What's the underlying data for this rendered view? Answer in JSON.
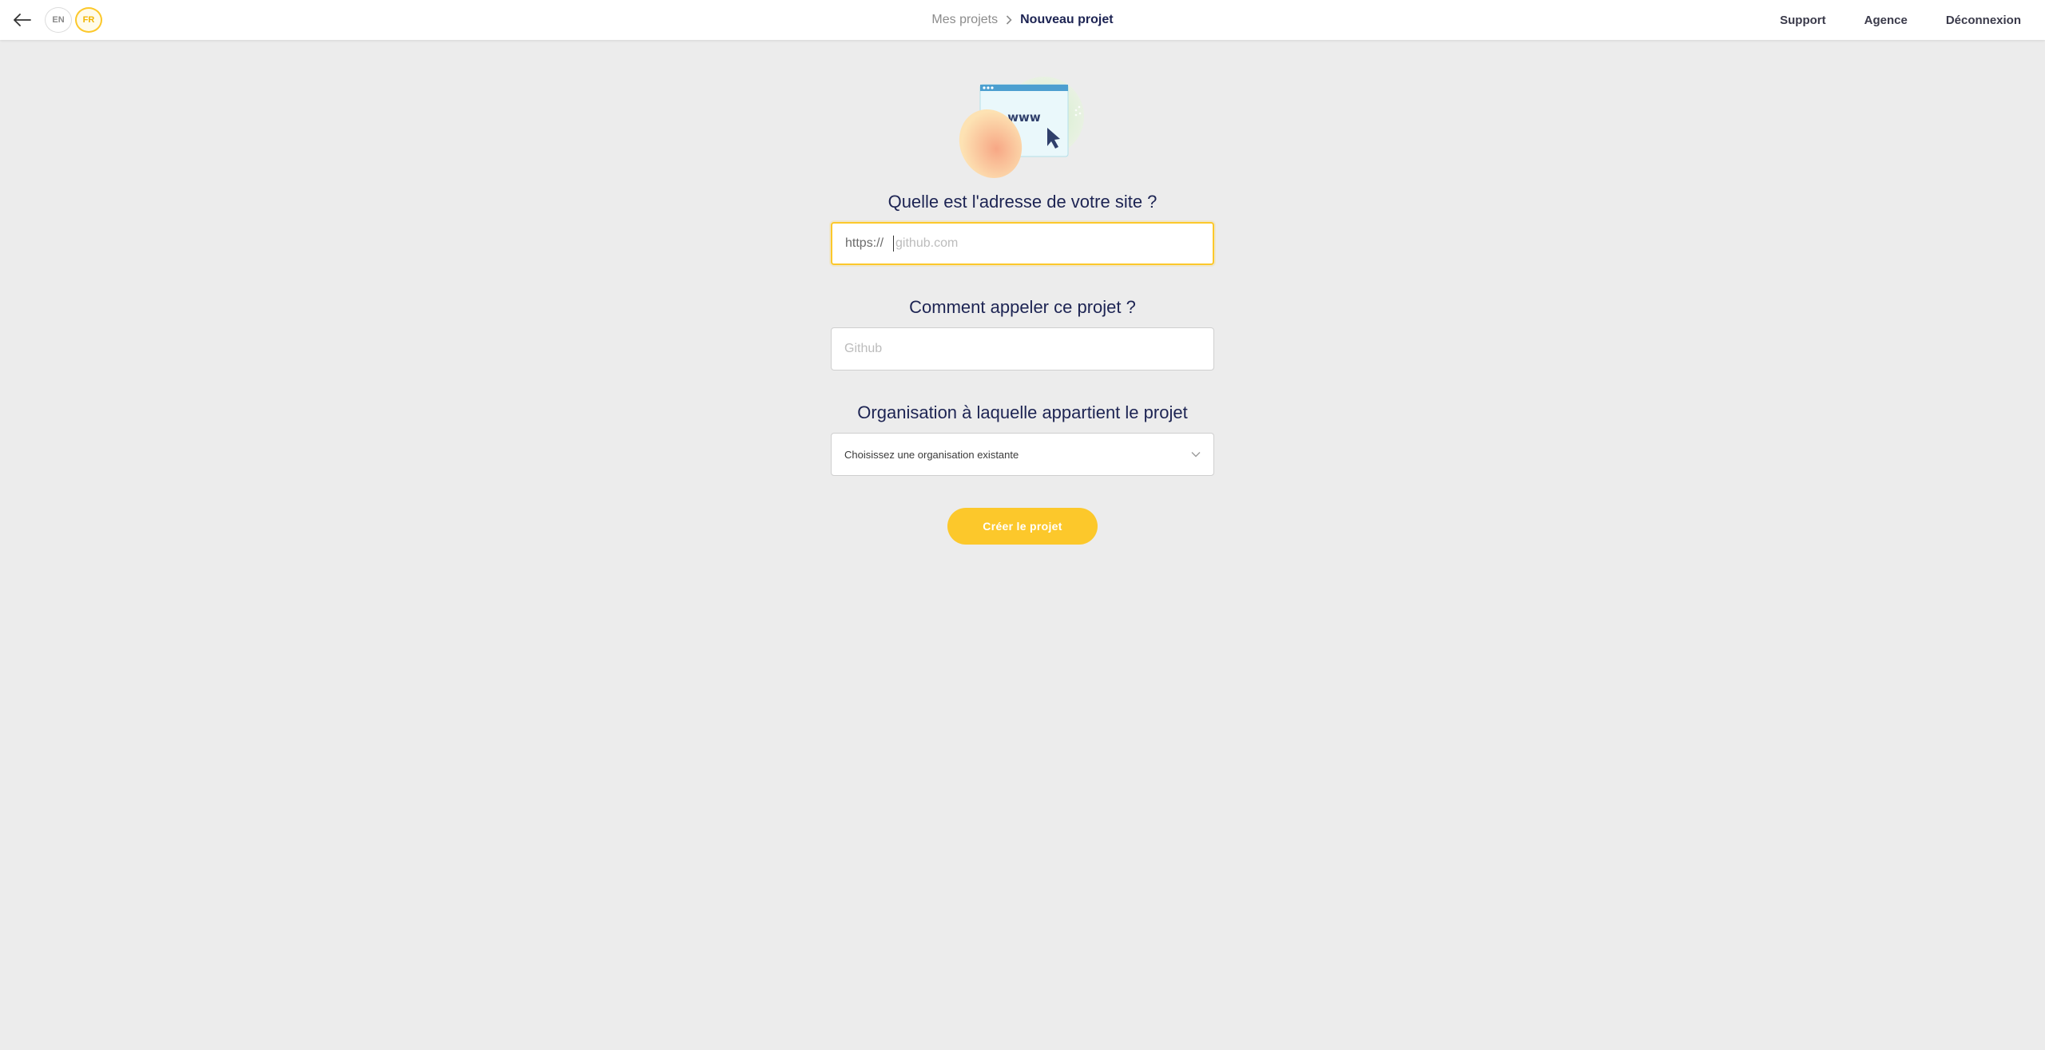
{
  "header": {
    "languages": [
      {
        "code": "EN",
        "active": false
      },
      {
        "code": "FR",
        "active": true
      }
    ],
    "breadcrumb": {
      "previous": "Mes projets",
      "current": "Nouveau projet"
    },
    "nav": {
      "support": "Support",
      "agency": "Agence",
      "logout": "Déconnexion"
    }
  },
  "illustration": {
    "text": "www"
  },
  "form": {
    "url_question": "Quelle est l'adresse de votre site ?",
    "url_prefix": "https://",
    "url_placeholder": "github.com",
    "name_question": "Comment appeler ce projet ?",
    "name_placeholder": "Github",
    "org_question": "Organisation à laquelle appartient le projet",
    "org_select_value": "Choisissez une organisation existante",
    "submit_label": "Créer le projet"
  },
  "colors": {
    "accent": "#fcc82b",
    "text_primary": "#1d2453",
    "background": "#ececec"
  },
  "icons": {
    "back": "arrow-left-icon",
    "breadcrumb_separator": "chevron-right-icon",
    "select": "chevron-down-icon"
  }
}
